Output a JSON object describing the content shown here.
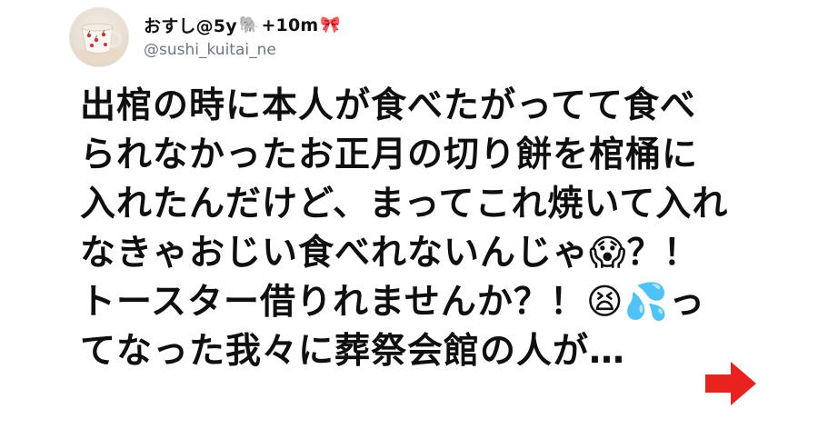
{
  "user": {
    "display_name": "おすし@5y",
    "display_name_suffix": "+10m",
    "emoji_1": "🐘",
    "emoji_2": "🎀",
    "handle": "@sushi_kuitai_ne"
  },
  "tweet": {
    "lines": [
      "出棺の時に本人が食べたがってて食べ",
      "られなかったお正月の切り餅を棺桶に",
      "入れたんだけど、まってこれ焼いて入れ",
      "なきゃおじい食べれないんじゃ😱？！",
      "トースター借りれませんか？！😫💦っ",
      "てなった我々に葬祭会館の人が…"
    ]
  },
  "icons": {
    "avatar": "coffee-cup-avatar",
    "next": "red-right-arrow-icon"
  },
  "colors": {
    "arrow": "#e8231f",
    "handle": "#6b7680",
    "text": "#0f0f0f"
  }
}
